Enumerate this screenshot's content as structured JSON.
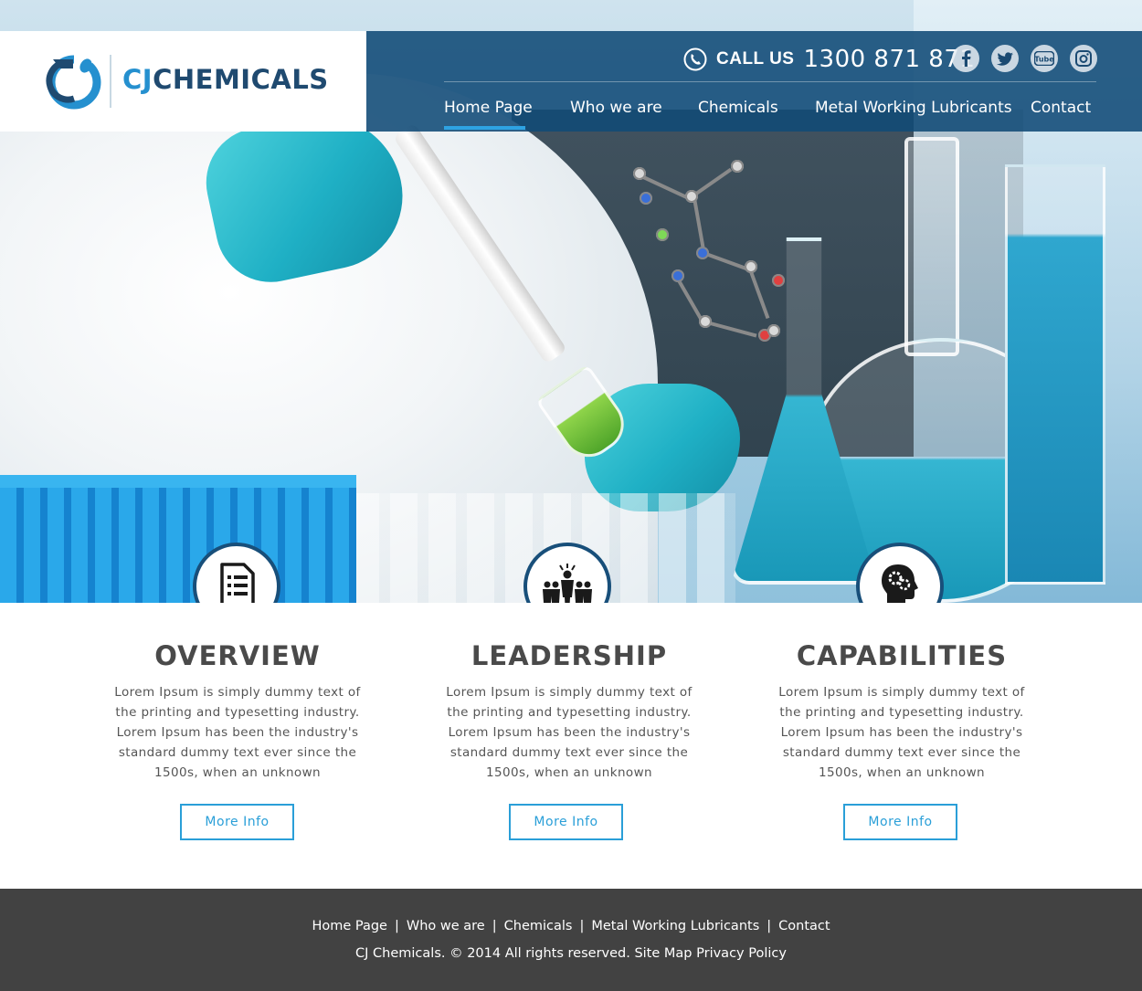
{
  "brand": {
    "name_part1": "CJ",
    "name_part2": "CHEMICALS",
    "colors": {
      "primary": "#1f4a70",
      "accent": "#2590cf",
      "header_bar": "#104a76",
      "footer": "#424242"
    }
  },
  "header": {
    "call_label": "CALL US",
    "phone": "1300 871 871",
    "social": [
      {
        "name": "facebook-icon",
        "glyph": "f"
      },
      {
        "name": "twitter-icon",
        "glyph": "t"
      },
      {
        "name": "youtube-icon",
        "glyph": "You Tube"
      },
      {
        "name": "instagram-icon",
        "glyph": "◎"
      }
    ]
  },
  "nav": {
    "items": [
      {
        "label": "Home Page",
        "active": true
      },
      {
        "label": "Who we are",
        "active": false
      },
      {
        "label": "Chemicals",
        "active": false
      },
      {
        "label": "Metal Working Lubricants",
        "active": false
      },
      {
        "label": "Contact",
        "active": false
      }
    ]
  },
  "features": [
    {
      "icon": "document-list-icon",
      "title": "OVERVIEW",
      "text": "Lorem Ipsum is simply dummy text of the printing and typesetting industry. Lorem Ipsum has been the industry's standard dummy text ever since the 1500s, when an unknown",
      "button": "More Info"
    },
    {
      "icon": "leader-group-icon",
      "title": "LEADERSHIP",
      "text": "Lorem Ipsum is simply dummy text of the printing and typesetting industry. Lorem Ipsum has been the industry's standard dummy text ever since the 1500s, when an unknown",
      "button": "More Info"
    },
    {
      "icon": "head-gears-icon",
      "title": "CAPABILITIES",
      "text": "Lorem Ipsum is simply dummy text of the printing and typesetting industry. Lorem Ipsum has been the industry's standard dummy text ever since the 1500s, when an unknown",
      "button": "More Info"
    }
  ],
  "footer": {
    "links": [
      "Home Page",
      "Who we are",
      "Chemicals",
      "Metal Working Lubricants",
      "Contact"
    ],
    "separator": "|",
    "copyright": "CJ Chemicals. © 2014 All rights reserved.",
    "sitemap": "Site Map",
    "privacy": "Privacy Policy"
  }
}
